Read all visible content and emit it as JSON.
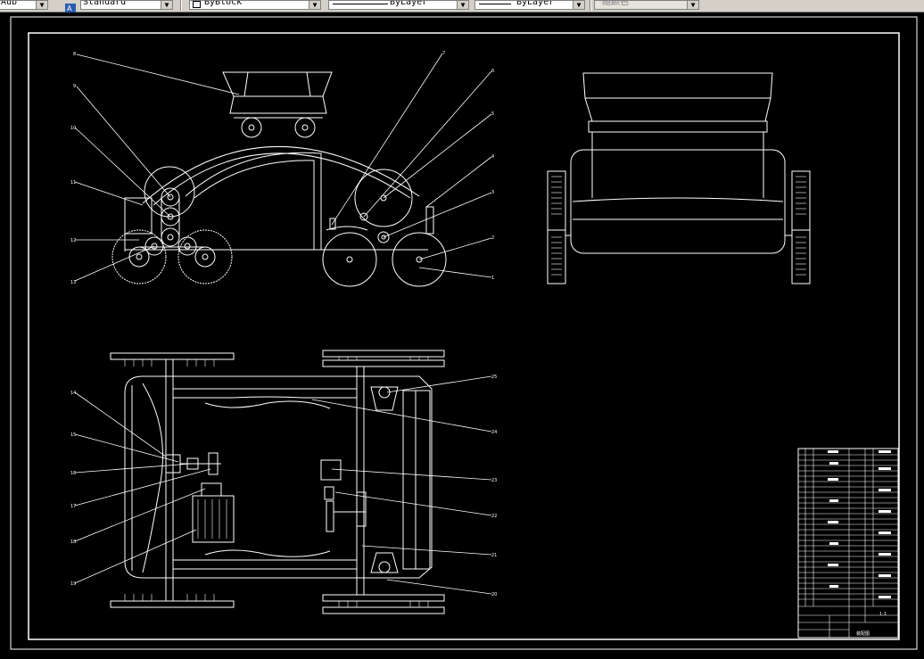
{
  "toolbar": {
    "text_style": "Standard",
    "dim_style_partial": "Aub",
    "color_control": "ByBlock",
    "linetype_control": "ByLayer",
    "lineweight_control": "ByLayer",
    "plot_style": "随颜色"
  },
  "colors": {
    "canvas_bg": "#000000",
    "line": "#ffffff",
    "toolbar_bg": "#d4d0c8"
  },
  "drawing": {
    "front_view_callouts_left": [
      "8",
      "9",
      "10",
      "11",
      "12",
      "13"
    ],
    "front_view_callouts_right": [
      "7",
      "6",
      "5",
      "4",
      "3",
      "2",
      "1"
    ],
    "top_view_callouts_left": [
      "14",
      "15",
      "16",
      "17",
      "18",
      "19"
    ],
    "top_view_callouts_right": [
      "25",
      "24",
      "23",
      "22",
      "21",
      "20"
    ]
  },
  "title_block": {
    "scale": "1:1",
    "drawing_title": "装配图"
  }
}
